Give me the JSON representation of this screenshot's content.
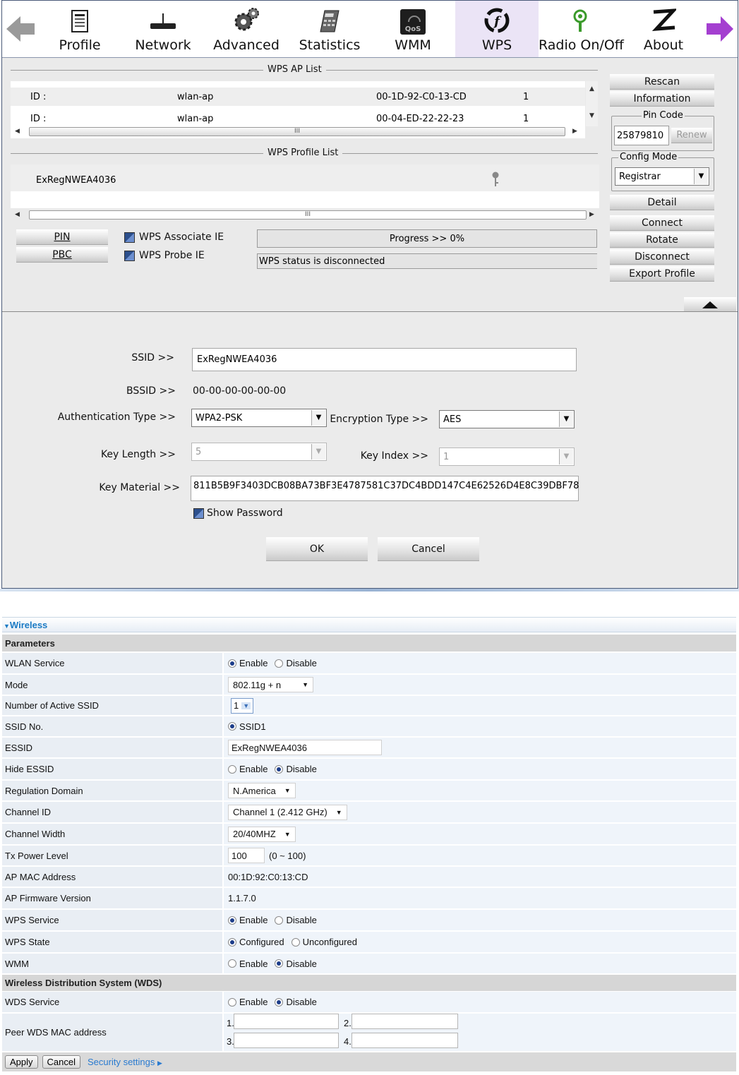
{
  "toolbar": {
    "items": [
      {
        "label": "Profile",
        "icon": "profile-icon"
      },
      {
        "label": "Network",
        "icon": "network-icon"
      },
      {
        "label": "Advanced",
        "icon": "gears-icon"
      },
      {
        "label": "Statistics",
        "icon": "calculator-icon"
      },
      {
        "label": "WMM",
        "icon": "qos-icon"
      },
      {
        "label": "WPS",
        "icon": "wps-icon",
        "active": true
      },
      {
        "label": "Radio On/Off",
        "icon": "radio-icon"
      },
      {
        "label": "About",
        "icon": "about-icon"
      }
    ],
    "colors": {
      "active": "#ebe4f6",
      "back_arrow": "#9a9a9a",
      "forward_arrow": "#a43fd0"
    }
  },
  "wps": {
    "ap_list_title": "WPS AP List",
    "ap_list": [
      {
        "id": "ID :",
        "ssid": "wlan-ap",
        "mac": "00-1D-92-C0-13-CD",
        "channel": "1"
      },
      {
        "id": "ID :",
        "ssid": "wlan-ap",
        "mac": "00-04-ED-22-22-23",
        "channel": "1"
      }
    ],
    "profile_list_title": "WPS Profile List",
    "profile_list": [
      "ExRegNWEA4036"
    ],
    "scroll_thumb": "III",
    "pin_button": "PIN",
    "pbc_button": "PBC",
    "associate_ie": "WPS Associate IE",
    "probe_ie": "WPS Probe IE",
    "progress": "Progress >> 0%",
    "status": "WPS status is disconnected",
    "side": {
      "rescan": "Rescan",
      "information": "Information",
      "pin_code_title": "Pin Code",
      "pin_code": "25879810",
      "renew": "Renew",
      "config_mode_title": "Config Mode",
      "config_mode": "Registrar",
      "detail": "Detail",
      "connect": "Connect",
      "rotate": "Rotate",
      "disconnect": "Disconnect",
      "export_profile": "Export Profile"
    },
    "detail": {
      "ssid_label": "SSID >>",
      "ssid": "ExRegNWEA4036",
      "bssid_label": "BSSID >>",
      "bssid": "00-00-00-00-00-00",
      "auth_label": "Authentication Type >>",
      "auth": "WPA2-PSK",
      "enc_label": "Encryption Type >>",
      "enc": "AES",
      "keylen_label": "Key Length >>",
      "keylen": "5",
      "keyidx_label": "Key Index >>",
      "keyidx": "1",
      "keymat_label": "Key Material >>",
      "keymat": "811B5B9F3403DCB08BA73BF3E4787581C37DC4BDD147C4E62526D4E8C39DBF78",
      "show_password": "Show Password",
      "ok": "OK",
      "cancel": "Cancel"
    }
  },
  "wireless": {
    "header": "Wireless",
    "parameters": "Parameters",
    "wlan_service": {
      "label": "WLAN Service",
      "opt1": "Enable",
      "opt2": "Disable",
      "selected": "Enable"
    },
    "mode": {
      "label": "Mode",
      "value": "802.11g + n"
    },
    "active_ssid": {
      "label": "Number of Active SSID",
      "value": "1"
    },
    "ssid_no": {
      "label": "SSID No.",
      "value": "SSID1"
    },
    "essid": {
      "label": "ESSID",
      "value": "ExRegNWEA4036"
    },
    "hide_essid": {
      "label": "Hide ESSID",
      "opt1": "Enable",
      "opt2": "Disable",
      "selected": "Disable"
    },
    "regulation": {
      "label": "Regulation Domain",
      "value": "N.America"
    },
    "channel_id": {
      "label": "Channel ID",
      "value": "Channel 1 (2.412 GHz)"
    },
    "channel_width": {
      "label": "Channel Width",
      "value": "20/40MHZ"
    },
    "tx_power": {
      "label": "Tx Power Level",
      "value": "100",
      "range": "(0 ~ 100)"
    },
    "ap_mac": {
      "label": "AP MAC Address",
      "value": "00:1D:92:C0:13:CD"
    },
    "ap_fw": {
      "label": "AP Firmware Version",
      "value": "1.1.7.0"
    },
    "wps_service": {
      "label": "WPS Service",
      "opt1": "Enable",
      "opt2": "Disable",
      "selected": "Enable"
    },
    "wps_state": {
      "label": "WPS State",
      "opt1": "Configured",
      "opt2": "Unconfigured",
      "selected": "Configured"
    },
    "wmm": {
      "label": "WMM",
      "opt1": "Enable",
      "opt2": "Disable",
      "selected": "Disable"
    },
    "wds_header": "Wireless Distribution System (WDS)",
    "wds_service": {
      "label": "WDS Service",
      "opt1": "Enable",
      "opt2": "Disable",
      "selected": "Disable"
    },
    "peer_wds": {
      "label": "Peer WDS MAC address",
      "n1": "1.",
      "n2": "2.",
      "n3": "3.",
      "n4": "4."
    },
    "apply": "Apply",
    "cancel": "Cancel",
    "security_link": "Security settings"
  }
}
